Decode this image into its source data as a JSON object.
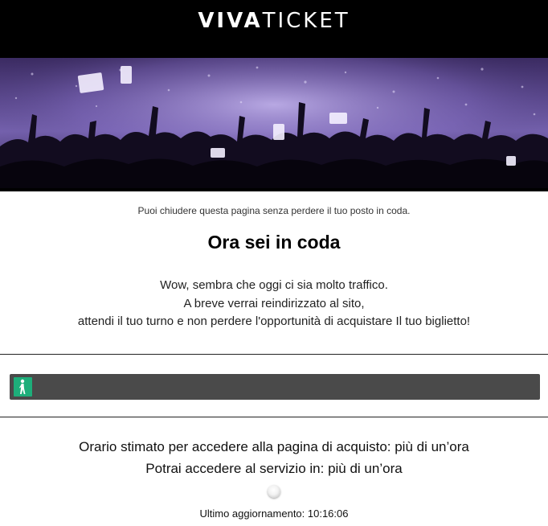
{
  "header": {
    "logo_bold": "VIVA",
    "logo_light": "TICKET"
  },
  "hero": {
    "image": "concert-crowd-photo"
  },
  "queue": {
    "notice": "Puoi chiudere questa pagina senza perdere il tuo posto in coda.",
    "title": "Ora sei in coda",
    "message_line1": "Wow, sembra che oggi ci sia molto traffico.",
    "message_line2": "A breve verrai reindirizzato al sito,",
    "message_line3": "attendi il tuo turno e non perdere l'opportunità di acquistare Il tuo biglietto!"
  },
  "progress": {
    "fraction": 0.035,
    "icon": "walking-person-icon"
  },
  "status": {
    "estimated_time": "Orario stimato per accedere alla pagina di acquisto: più di un’ora",
    "access_in": "Potrai accedere al servizio in: più di un’ora",
    "last_update": "Ultimo aggiornamento: 10:16:06"
  },
  "colors": {
    "header_bg": "#000000",
    "progress_track": "#4a4a4a",
    "progress_fill": "#1dae7a",
    "hero_tint": "#6a55a6"
  }
}
